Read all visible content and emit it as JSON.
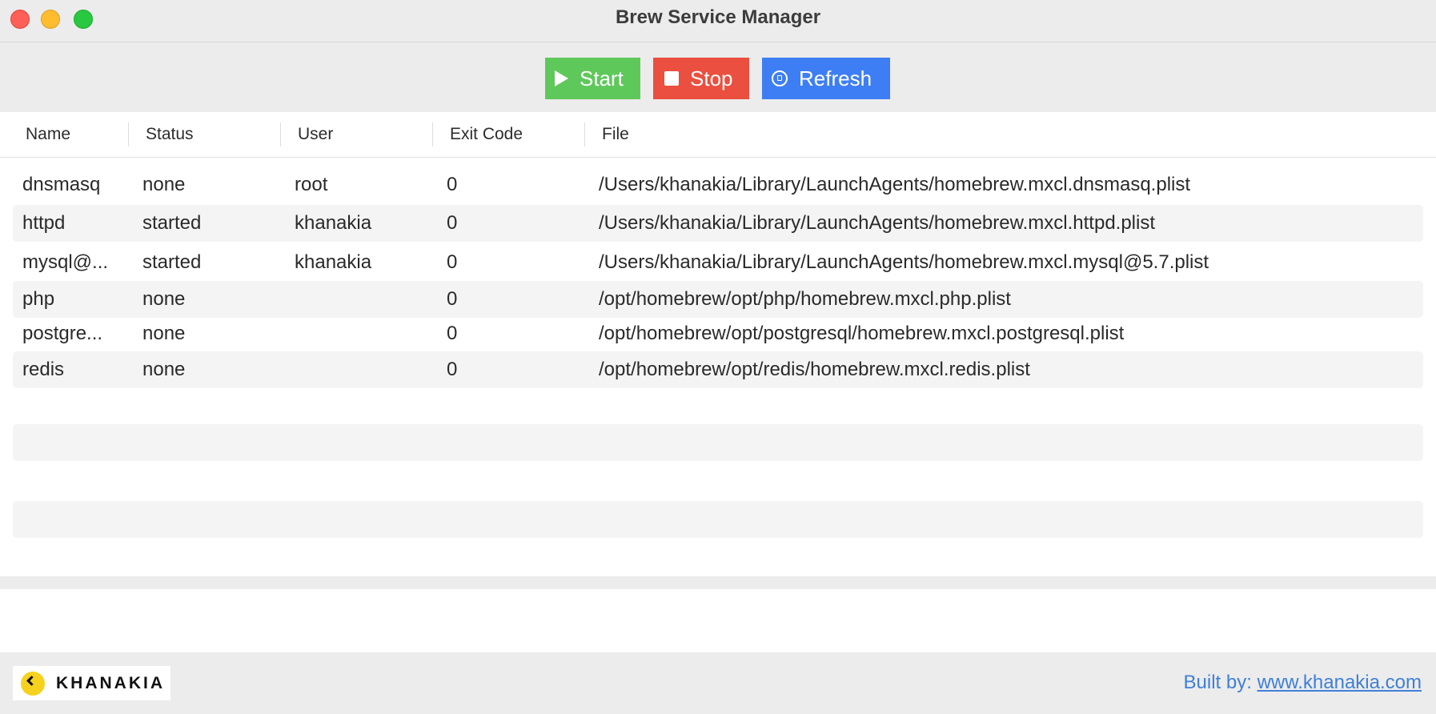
{
  "window": {
    "title": "Brew Service Manager"
  },
  "toolbar": {
    "start_label": "Start",
    "stop_label": "Stop",
    "refresh_label": "Refresh"
  },
  "table": {
    "columns": [
      "Name",
      "Status",
      "User",
      "Exit Code",
      "File"
    ],
    "rows": [
      {
        "name": "dnsmasq",
        "status": "none",
        "user": "root",
        "exit_code": "0",
        "file": "/Users/khanakia/Library/LaunchAgents/homebrew.mxcl.dnsmasq.plist"
      },
      {
        "name": "httpd",
        "status": "started",
        "user": "khanakia",
        "exit_code": "0",
        "file": "/Users/khanakia/Library/LaunchAgents/homebrew.mxcl.httpd.plist"
      },
      {
        "name": "mysql@...",
        "status": "started",
        "user": "khanakia",
        "exit_code": "0",
        "file": "/Users/khanakia/Library/LaunchAgents/homebrew.mxcl.mysql@5.7.plist"
      },
      {
        "name": "php",
        "status": "none",
        "user": "",
        "exit_code": "0",
        "file": "/opt/homebrew/opt/php/homebrew.mxcl.php.plist"
      },
      {
        "name": "postgre...",
        "status": "none",
        "user": "",
        "exit_code": "0",
        "file": "/opt/homebrew/opt/postgresql/homebrew.mxcl.postgresql.plist"
      },
      {
        "name": "redis",
        "status": "none",
        "user": "",
        "exit_code": "0",
        "file": "/opt/homebrew/opt/redis/homebrew.mxcl.redis.plist"
      }
    ]
  },
  "footer": {
    "logo_text": "KHANAKIA",
    "built_prefix": "Built by: ",
    "built_link": "www.khanakia.com"
  },
  "colors": {
    "start": "#5fc85a",
    "stop": "#ea4f3f",
    "refresh": "#3e7ef4",
    "link": "#3f7fd9",
    "logo_accent": "#f6d21f"
  },
  "icons": {
    "start": "play-icon",
    "stop": "stop-icon",
    "refresh": "refresh-icon",
    "logo": "khanakia-logo-icon"
  }
}
